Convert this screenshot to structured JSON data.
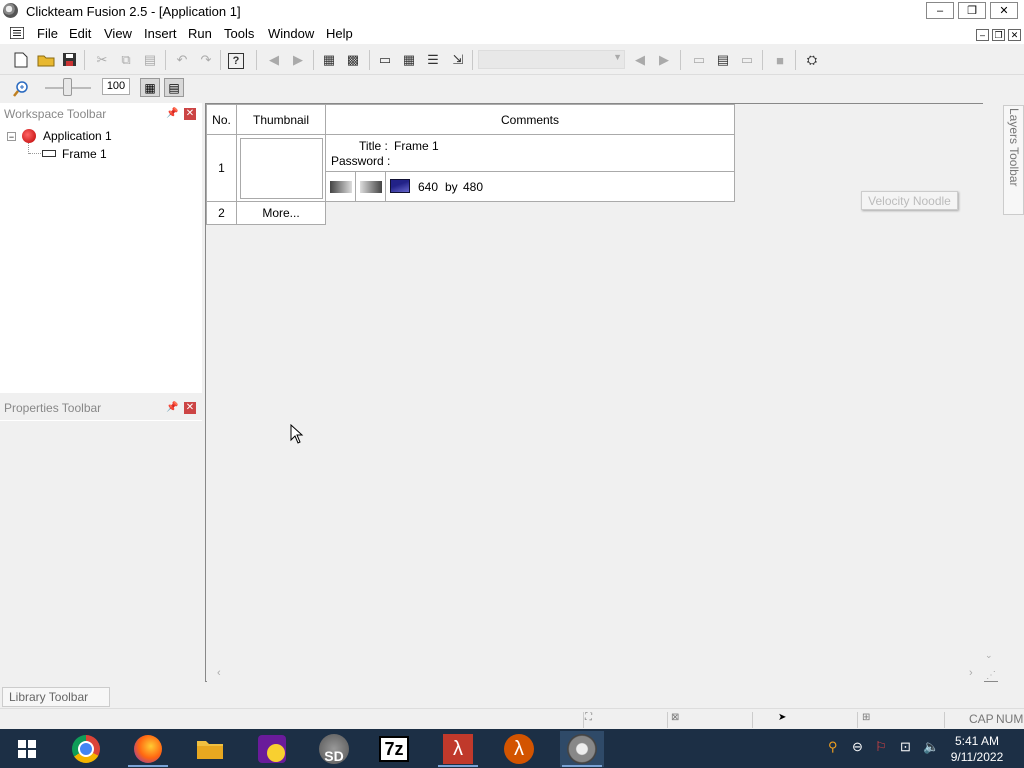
{
  "window": {
    "title": "Clickteam Fusion 2.5 - [Application 1]",
    "minimize": "‒",
    "maximize": "❐",
    "close": "✕"
  },
  "menu": [
    "File",
    "Edit",
    "View",
    "Insert",
    "Run",
    "Tools",
    "Window",
    "Help"
  ],
  "mdi": {
    "minimize": "‒",
    "restore": "❐",
    "close": "✕"
  },
  "toolbar2": {
    "zoom": "100"
  },
  "workspace": {
    "title": "Workspace Toolbar",
    "tree": {
      "application": "Application 1",
      "frame": "Frame 1"
    }
  },
  "properties": {
    "title": "Properties Toolbar"
  },
  "library": {
    "label": "Library Toolbar"
  },
  "storyboard": {
    "headers": {
      "no": "No.",
      "thumbnail": "Thumbnail",
      "comments": "Comments"
    },
    "rows": [
      {
        "no": "1",
        "title_label": "Title :",
        "title_value": "Frame 1",
        "password_label": "Password :",
        "size_width": "640",
        "size_by": "by",
        "size_height": "480"
      },
      {
        "no": "2",
        "more": "More..."
      }
    ]
  },
  "tooltip": "Velocity Noodle",
  "layers_toolbar": "Layers Toolbar",
  "status": {
    "cap": "CAP",
    "num": "NUM"
  },
  "taskbar": {
    "apps": [
      "windows-start",
      "chrome",
      "firefox",
      "file-explorer",
      "yahoo-messenger",
      "sd",
      "7zip",
      "half-life",
      "half-life-2",
      "clickteam-fusion"
    ],
    "labels": {
      "sd": "SD",
      "7zip": "7z"
    },
    "clock_time": "5:41 AM",
    "clock_date": "9/11/2022"
  }
}
